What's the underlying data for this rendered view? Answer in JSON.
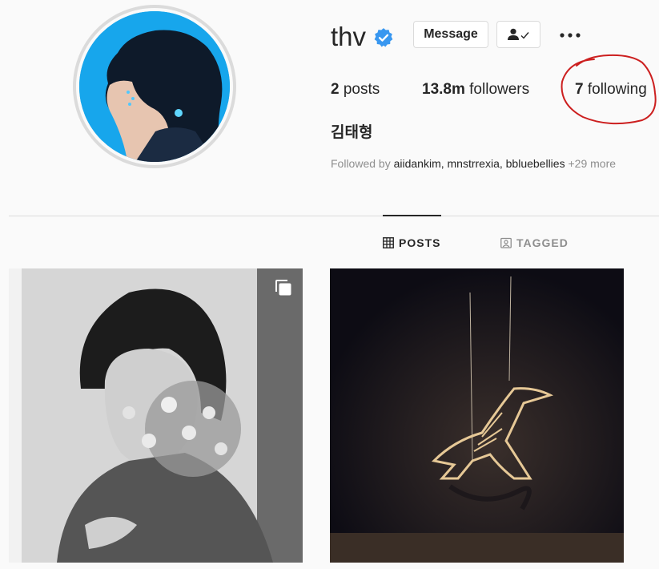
{
  "profile": {
    "username": "thv",
    "verified_icon": "verified-badge-icon",
    "full_name": "김태형",
    "buttons": {
      "message": "Message",
      "follow_icon": "person-check-icon",
      "more_icon": "ellipsis-icon"
    },
    "stats": {
      "posts_count": "2",
      "posts_label": "posts",
      "followers_count": "13.8m",
      "followers_label": "followers",
      "following_count": "7",
      "following_label": "following"
    },
    "followed_by": {
      "prefix": "Followed by",
      "names": "aiidankim, mnstrrexia, bbluebellies",
      "more": "+29 more"
    }
  },
  "tabs": [
    {
      "label": "POSTS",
      "icon": "grid-icon",
      "active": true
    },
    {
      "label": "TAGGED",
      "icon": "tagged-icon",
      "active": false
    }
  ],
  "posts": [
    {
      "icon": "multiple-photos-icon"
    },
    {
      "icon": ""
    }
  ],
  "colors": {
    "verified": "#3897f0",
    "annotation": "#cc1f1f",
    "text": "#262626",
    "muted": "#8e8e8e"
  }
}
